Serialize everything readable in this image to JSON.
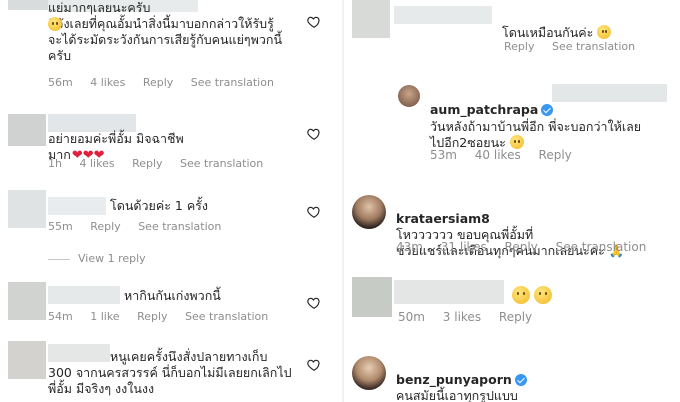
{
  "left": {
    "comments": [
      {
        "text": "แย่มากๆเลยนะครับ\n ดีจังเลยที่คุณอั้มนำสิ่งนี้มาบอกกล่าวให้รับรู้\nจะได้ระมัดระวังกันการเสียรู้กับคนแย่ๆพวกนี้\nครับ",
        "time": "56m",
        "likes": "4 likes",
        "reply": "Reply",
        "see_translation": "See translation"
      },
      {
        "text": "อย่ายอมค่ะพี่อั้ม มิจฉาชีพ\nมาก",
        "time": "1h",
        "likes": "4 likes",
        "reply": "Reply",
        "see_translation": "See translation"
      },
      {
        "text": "โดนด้วยค่ะ 1 ครั้ง",
        "time": "55m",
        "reply": "Reply",
        "see_translation": "See translation",
        "view_reply": "View 1 reply"
      },
      {
        "text": "หากินกันเก่งพวกนี้",
        "time": "54m",
        "likes": "1 like",
        "reply": "Reply",
        "see_translation": "See translation"
      },
      {
        "text": "หนูเคยครั้งนึงสั่งปลายทางเก็บ\n300 จากนครสวรรค์ นี่ก็บอกไม่มีเลยยกเลิกไป\nพี่อั้ม มีจริงๆ งงในงง"
      }
    ]
  },
  "right": {
    "comments": [
      {
        "text": "โดนเหมือนกันค่ะ",
        "reply": "Reply",
        "see_translation": "See translation"
      },
      {
        "username": "aum_patchrapa",
        "text": "วันหลังถ้ามาบ้านพี่อีก  พี่จะบอกว่าให้เลย\nไปอีก2ซอยนะ",
        "time": "53m",
        "likes": "40 likes",
        "reply": "Reply"
      },
      {
        "username": "krataersiam8",
        "text": "โหวววววว ขอบคุณพี่อั้มที่\nช่วยแชร์และเตือนทุกๆคนมากเลยนะคะ",
        "time": "43m",
        "likes": "31 likes",
        "reply": "Reply",
        "see_translation": "See translation"
      },
      {
        "time": "50m",
        "likes": "3 likes",
        "reply": "Reply"
      },
      {
        "username": "benz_punyaporn",
        "text": "คนสมัยนี้เอาทุกรูปแบบ\nจริงๆ"
      }
    ]
  },
  "colors": {
    "muted": "#8e8e8e",
    "text": "#262626",
    "verified": "#3897f0",
    "heart": "#e0203a"
  }
}
